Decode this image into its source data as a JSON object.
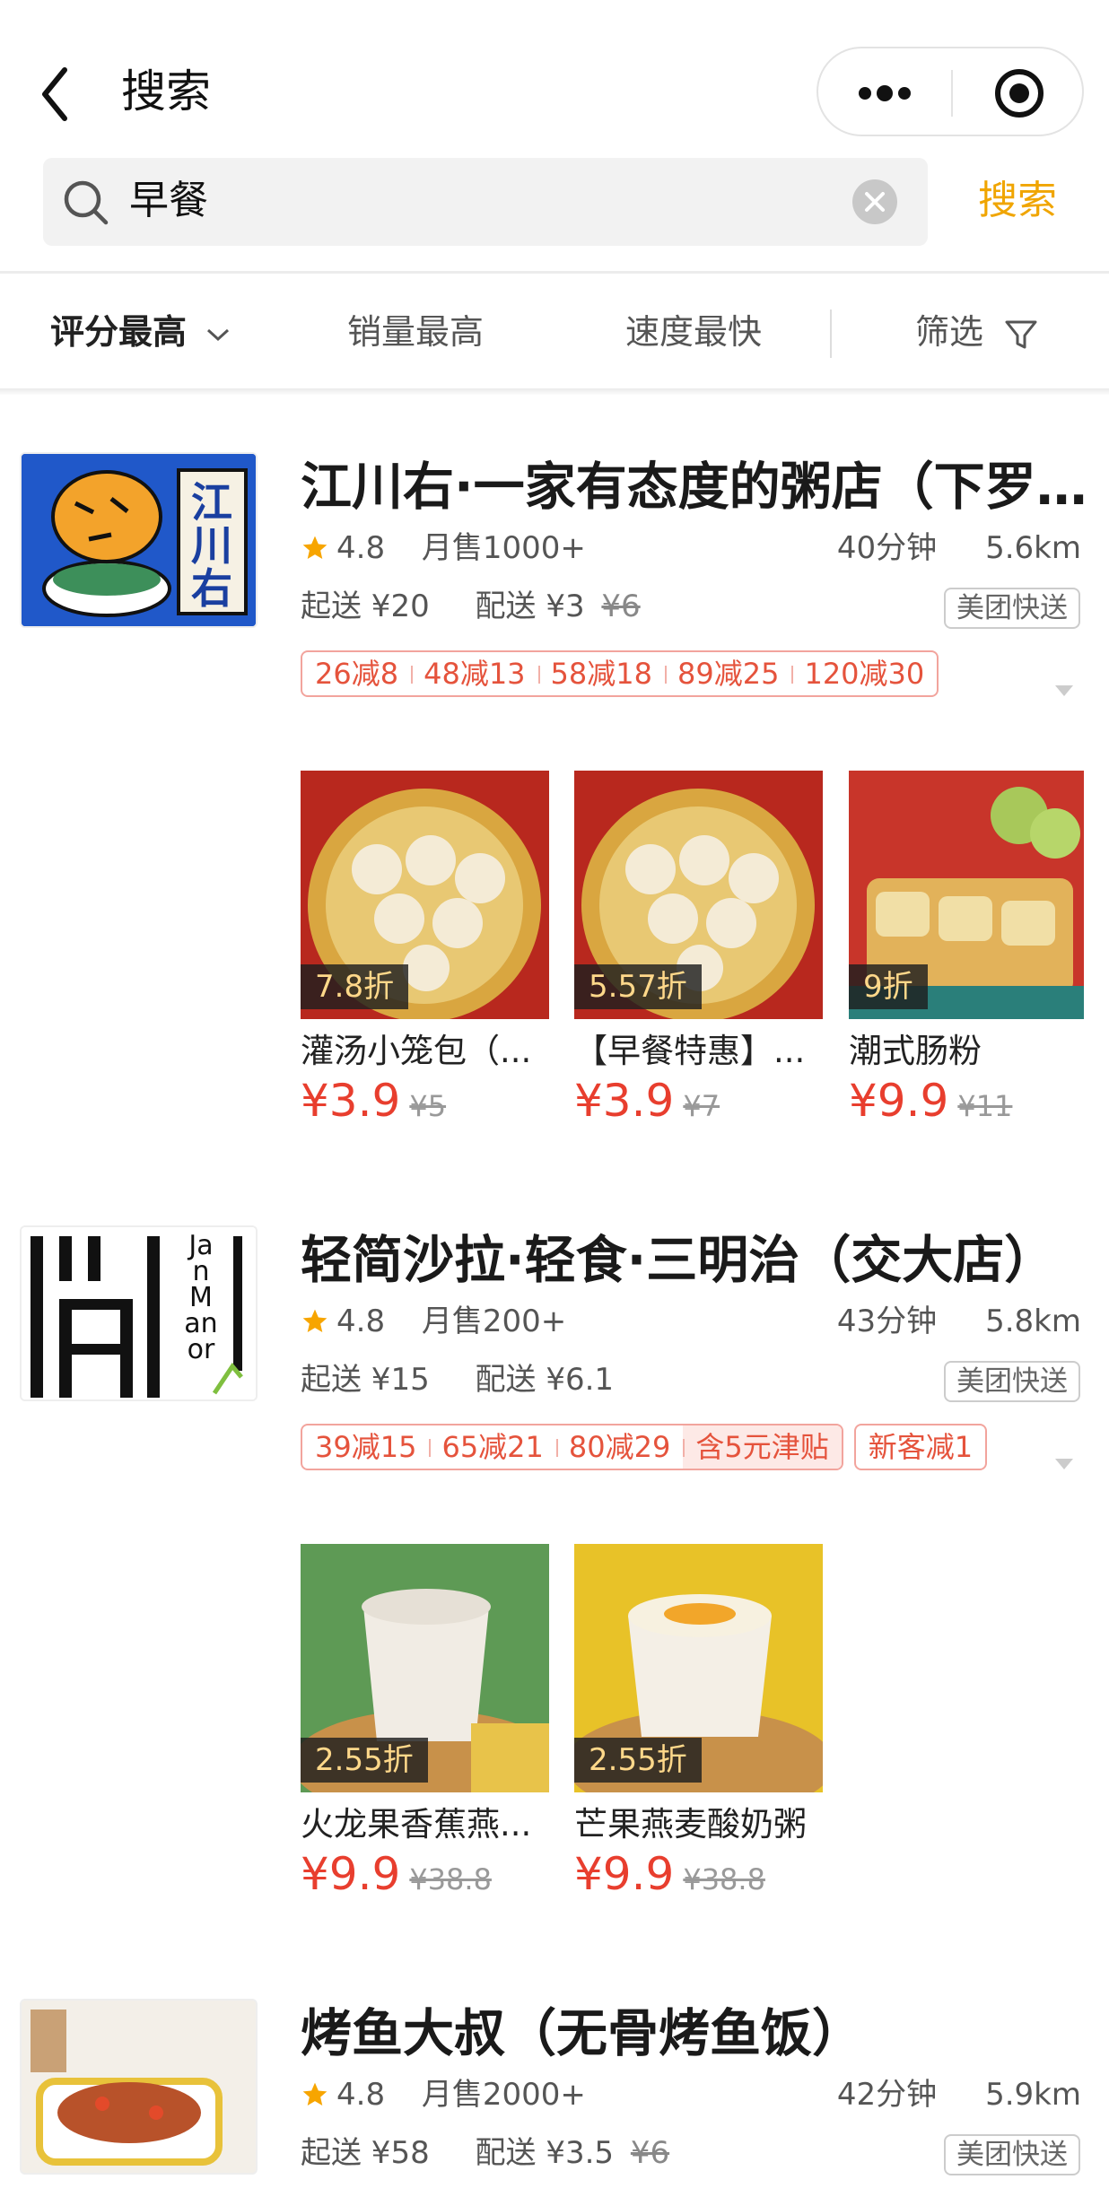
{
  "header": {
    "title": "搜索"
  },
  "search": {
    "query": "早餐",
    "button": "搜索"
  },
  "sort": {
    "rating": "评分最高",
    "sales": "销量最高",
    "speed": "速度最快",
    "filter": "筛选"
  },
  "shops": [
    {
      "name": "江川右·一家有态度的粥店（下罗...",
      "logo_text": "江川右",
      "rating": "4.8",
      "monthly_sales": "月售1000+",
      "time": "40分钟",
      "distance": "5.6km",
      "min_order": "起送 ¥20",
      "delivery_fee": "配送 ¥3",
      "delivery_fee_orig": "¥6",
      "delivery_tag": "美团快送",
      "promos": [
        "26减8",
        "48减13",
        "58减18",
        "89减25",
        "120减30"
      ],
      "dishes": [
        {
          "discount": "7.8折",
          "name": "灌汤小笼包（...",
          "price": "¥3.9",
          "orig": "¥5"
        },
        {
          "discount": "5.57折",
          "name": "【早餐特惠】...",
          "price": "¥3.9",
          "orig": "¥7"
        },
        {
          "discount": "9折",
          "name": "潮式肠粉",
          "price": "¥9.9",
          "orig": "¥11"
        }
      ]
    },
    {
      "name": "轻简沙拉·轻食·三明治（交大店）",
      "logo_text": "Jan Manor",
      "rating": "4.8",
      "monthly_sales": "月售200+",
      "time": "43分钟",
      "distance": "5.8km",
      "min_order": "起送 ¥15",
      "delivery_fee": "配送 ¥6.1",
      "delivery_tag": "美团快送",
      "promos": [
        "39减15",
        "65减21",
        "80减29"
      ],
      "promo_subsidy": "含5元津贴",
      "promo_new": "新客减1",
      "dishes": [
        {
          "discount": "2.55折",
          "name": "火龙果香蕉燕...",
          "price": "¥9.9",
          "orig": "¥38.8"
        },
        {
          "discount": "2.55折",
          "name": "芒果燕麦酸奶粥",
          "price": "¥9.9",
          "orig": "¥38.8"
        }
      ]
    },
    {
      "name": "烤鱼大叔（无骨烤鱼饭）",
      "rating": "4.8",
      "monthly_sales": "月售2000+",
      "time": "42分钟",
      "distance": "5.9km",
      "min_order": "起送 ¥58",
      "delivery_fee": "配送 ¥3.5",
      "delivery_fee_orig": "¥6",
      "delivery_tag": "美团快送"
    }
  ],
  "icons": {
    "back": "back-arrow-icon",
    "more": "more-dots-icon",
    "target": "target-icon",
    "search": "search-icon",
    "clear": "clear-icon",
    "filter": "filter-funnel-icon",
    "star": "star-icon"
  },
  "colors": {
    "accent": "#f0a500",
    "price": "#e83e2e",
    "promo": "#e5533c"
  }
}
